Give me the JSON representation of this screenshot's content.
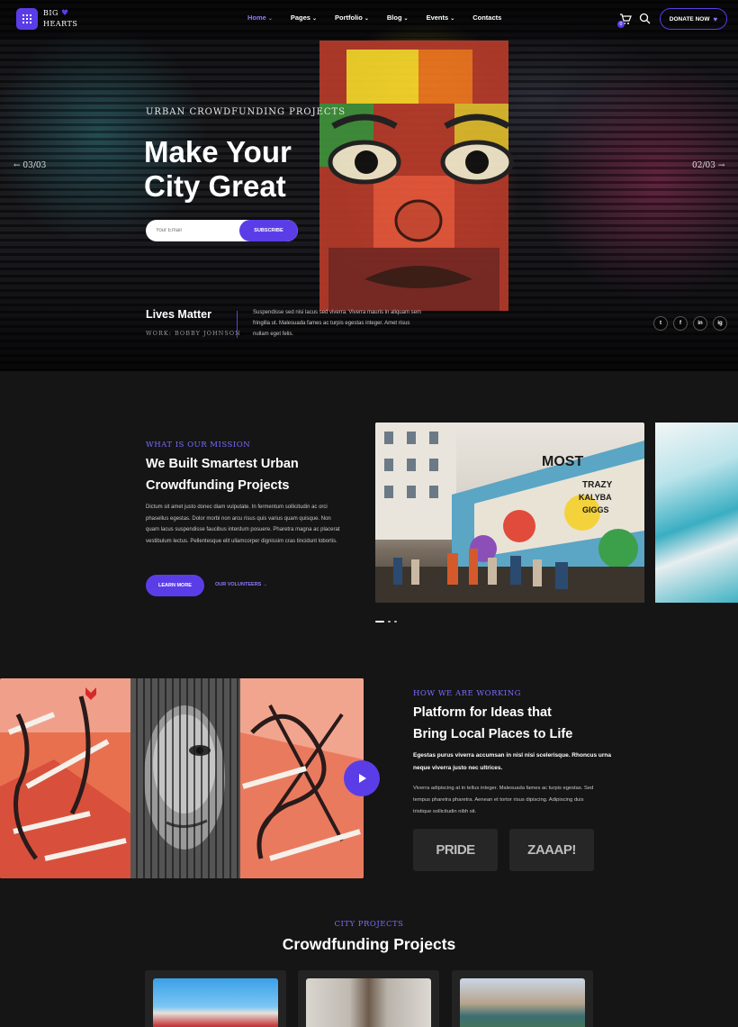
{
  "brand": {
    "logo_line1": "BIG",
    "logo_line2": "HEARTS",
    "accent": "#5b3de8",
    "accent_light": "#8b7bff",
    "logo_icon": "grid-icon"
  },
  "nav": {
    "items": [
      {
        "label": "Home",
        "chevron": true,
        "active": true
      },
      {
        "label": "Pages",
        "chevron": true
      },
      {
        "label": "Portfolio",
        "chevron": true
      },
      {
        "label": "Blog",
        "chevron": true
      },
      {
        "label": "Events",
        "chevron": true
      },
      {
        "label": "Contacts",
        "chevron": false
      }
    ],
    "cart_count": "0",
    "donate_label": "DONATE NOW"
  },
  "hero": {
    "eyebrow": "URBAN CROWDFUNDING PROJECTS",
    "title_line1": "Make Your",
    "title_line2": "City Great",
    "email_placeholder": "Your Email",
    "subscribe_label": "SUBSCRIBE",
    "prev_label": "03/03",
    "next_label": "02/03",
    "caption_title": "Lives Matter",
    "caption_sub": "WORK: BOBBY JOHNSON",
    "caption_text": "Suspendisse sed nisi lacus sed viverra. Viverra mauris in aliquam sem fringilla ut. Malesuada fames ac turpis egestas integer. Amet risus nullam eget felis.",
    "socials": [
      "t",
      "f",
      "in",
      "ig"
    ]
  },
  "mission": {
    "eyebrow": "WHAT IS OUR MISSION",
    "title_line1": "We Built Smartest Urban",
    "title_line2": "Crowdfunding Projects",
    "text": "Dictum sit amet justo donec diam vulputate. In fermentum sollicitudin ac orci phasellus egestas. Dolor morbi non arcu risus quis varius quam quisque. Non quam lacus suspendisse faucibus interdum posuere. Pharetra magna ac placerat vestibulum lectus. Pellentesque elit ullamcorper dignissim cras tincidunt lobortis.",
    "learn_more": "LEARN MORE",
    "volunteers": "OUR VOLUNTEERS",
    "mural_words": [
      "TRAZY",
      "KALYBA",
      "GIGGS",
      "MOST"
    ]
  },
  "platform": {
    "eyebrow": "HOW WE ARE WORKING",
    "title_line1": "Platform for Ideas that",
    "title_line2": "Bring Local Places to Life",
    "lead": "Egestas purus viverra accumsan in nisl nisi scelerisque. Rhoncus urna neque viverra justo nec ultrices.",
    "text": "Viverra adipiscing at in tellus integer. Malesuada fames ac turpis egestas. Sed tempus pharetra pharetra. Aenean et tortor risus dipiscing. Adipiscing duis tristique sollicitudin nibh sit.",
    "partners": [
      "PRIDE",
      "ZAAAP!"
    ]
  },
  "projects": {
    "eyebrow": "CITY PROJECTS",
    "title": "Crowdfunding Projects"
  }
}
